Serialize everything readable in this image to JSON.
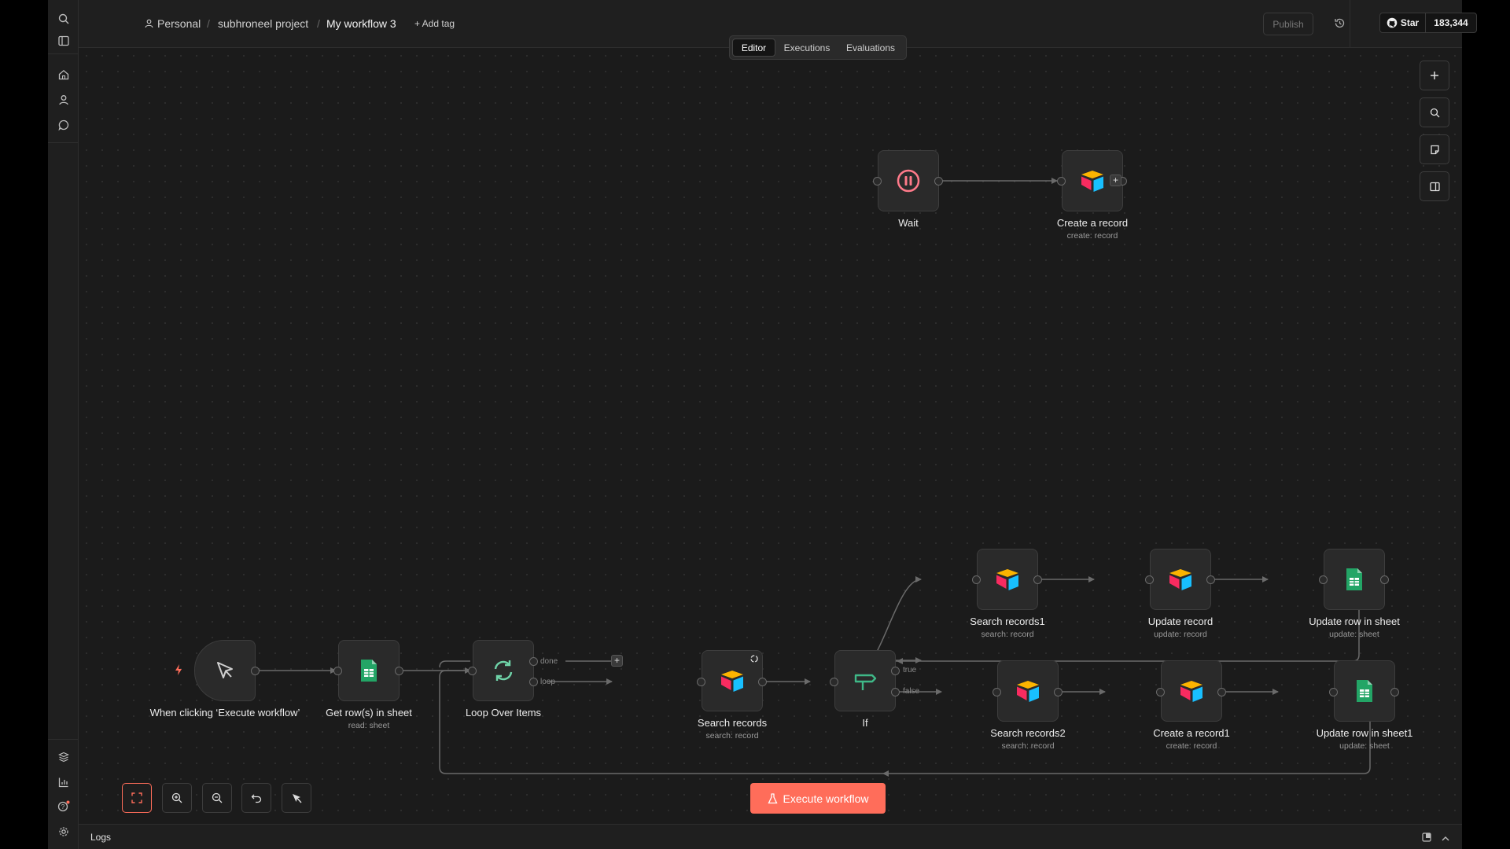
{
  "breadcrumb": {
    "owner": "Personal",
    "project": "subhroneel project",
    "workflow": "My workflow 3",
    "add_tag": "+ Add tag"
  },
  "header": {
    "publish": "Publish",
    "github_star": "Star",
    "github_count": "183,344"
  },
  "tabs": [
    {
      "label": "Editor",
      "active": true
    },
    {
      "label": "Executions",
      "active": false
    },
    {
      "label": "Evaluations",
      "active": false
    }
  ],
  "nodes": {
    "wait": {
      "label": "Wait"
    },
    "create_record": {
      "label": "Create a record",
      "sub": "create: record"
    },
    "trigger": {
      "label": "When clicking ‘Execute workflow’"
    },
    "get_rows": {
      "label": "Get row(s) in sheet",
      "sub": "read: sheet"
    },
    "loop": {
      "label": "Loop Over Items"
    },
    "search_records": {
      "label": "Search records",
      "sub": "search: record"
    },
    "if": {
      "label": "If"
    },
    "search_records1": {
      "label": "Search records1",
      "sub": "search: record"
    },
    "update_record": {
      "label": "Update record",
      "sub": "update: record"
    },
    "update_row": {
      "label": "Update row in sheet",
      "sub": "update: sheet"
    },
    "search_records2": {
      "label": "Search records2",
      "sub": "search: record"
    },
    "create_record1": {
      "label": "Create a record1",
      "sub": "create: record"
    },
    "update_row1": {
      "label": "Update row in sheet1",
      "sub": "update: sheet"
    }
  },
  "edge_labels": {
    "done": "done",
    "loop": "loop",
    "true": "true",
    "false": "false"
  },
  "execute_button": "Execute workflow",
  "logs_label": "Logs",
  "colors": {
    "accent": "#ff6d5a",
    "wait": "#ff7a8a",
    "sheets": "#23a566",
    "loop_icon": "#6fd3a8",
    "if_icon": "#3fb887"
  },
  "icons": {
    "trigger": "cursor-arrow-icon",
    "wait": "pause-icon",
    "airtable": "airtable-icon",
    "sheets": "google-sheets-icon",
    "loop": "refresh-icon",
    "if": "signpost-icon"
  }
}
